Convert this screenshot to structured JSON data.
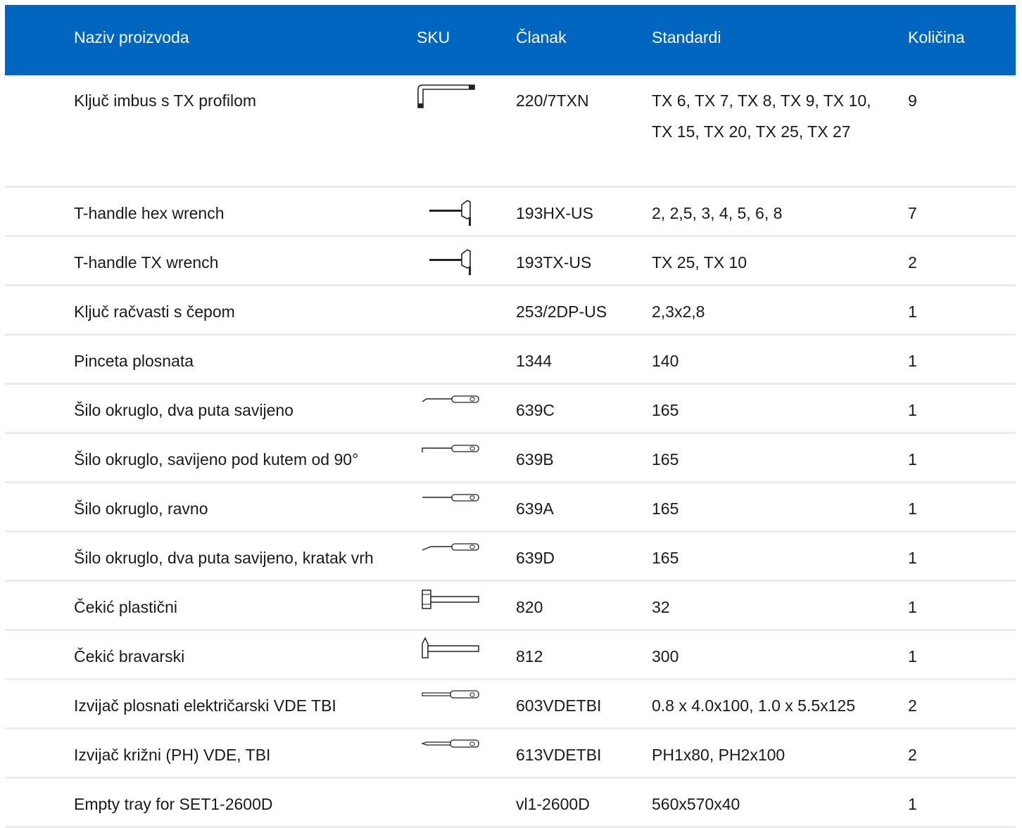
{
  "header": {
    "name": "Naziv proizvoda",
    "sku": "SKU",
    "article": "Članak",
    "standards": "Standardi",
    "qty": "Količina"
  },
  "rows": [
    {
      "name": "Ključ imbus s TX profilom",
      "icon": "l-key-icon",
      "article": "220/7TXN",
      "standards": "TX 6, TX 7, TX 8, TX 9, TX 10, TX 15, TX 20, TX 25, TX 27",
      "qty": "9"
    },
    {
      "name": "T-handle hex wrench",
      "icon": "t-handle-icon",
      "article": "193HX-US",
      "standards": "2, 2,5, 3, 4, 5, 6, 8",
      "qty": "7"
    },
    {
      "name": "T-handle TX wrench",
      "icon": "t-handle-icon",
      "article": "193TX-US",
      "standards": "TX 25, TX 10",
      "qty": "2"
    },
    {
      "name": "Ključ račvasti s čepom",
      "icon": "",
      "article": "253/2DP-US",
      "standards": "2,3x2,8",
      "qty": "1"
    },
    {
      "name": "Pinceta plosnata",
      "icon": "",
      "article": "1344",
      "standards": "140",
      "qty": "1"
    },
    {
      "name": "Šilo okruglo, dva puta savijeno",
      "icon": "awl-double-bent-icon",
      "article": "639C",
      "standards": "165",
      "qty": "1"
    },
    {
      "name": "Šilo okruglo, savijeno pod kutem od 90°",
      "icon": "awl-90-icon",
      "article": "639B",
      "standards": "165",
      "qty": "1"
    },
    {
      "name": "Šilo okruglo, ravno",
      "icon": "awl-straight-icon",
      "article": "639A",
      "standards": "165",
      "qty": "1"
    },
    {
      "name": "Šilo okruglo, dva puta savijeno, kratak vrh",
      "icon": "awl-double-bent-short-icon",
      "article": "639D",
      "standards": "165",
      "qty": "1"
    },
    {
      "name": "Čekić plastični",
      "icon": "plastic-hammer-icon",
      "article": "820",
      "standards": "32",
      "qty": "1"
    },
    {
      "name": "Čekić bravarski",
      "icon": "locksmith-hammer-icon",
      "article": "812",
      "standards": "300",
      "qty": "1"
    },
    {
      "name": "Izvijač plosnati električarski VDE TBI",
      "icon": "flat-screwdriver-icon",
      "article": "603VDETBI",
      "standards": "0.8 x 4.0x100, 1.0 x 5.5x125",
      "qty": "2"
    },
    {
      "name": "Izvijač križni (PH) VDE, TBI",
      "icon": "phillips-screwdriver-icon",
      "article": "613VDETBI",
      "standards": "PH1x80, PH2x100",
      "qty": "2"
    },
    {
      "name": "Empty tray for SET1-2600D",
      "icon": "",
      "article": "vl1-2600D",
      "standards": "560x570x40",
      "qty": "1"
    }
  ]
}
